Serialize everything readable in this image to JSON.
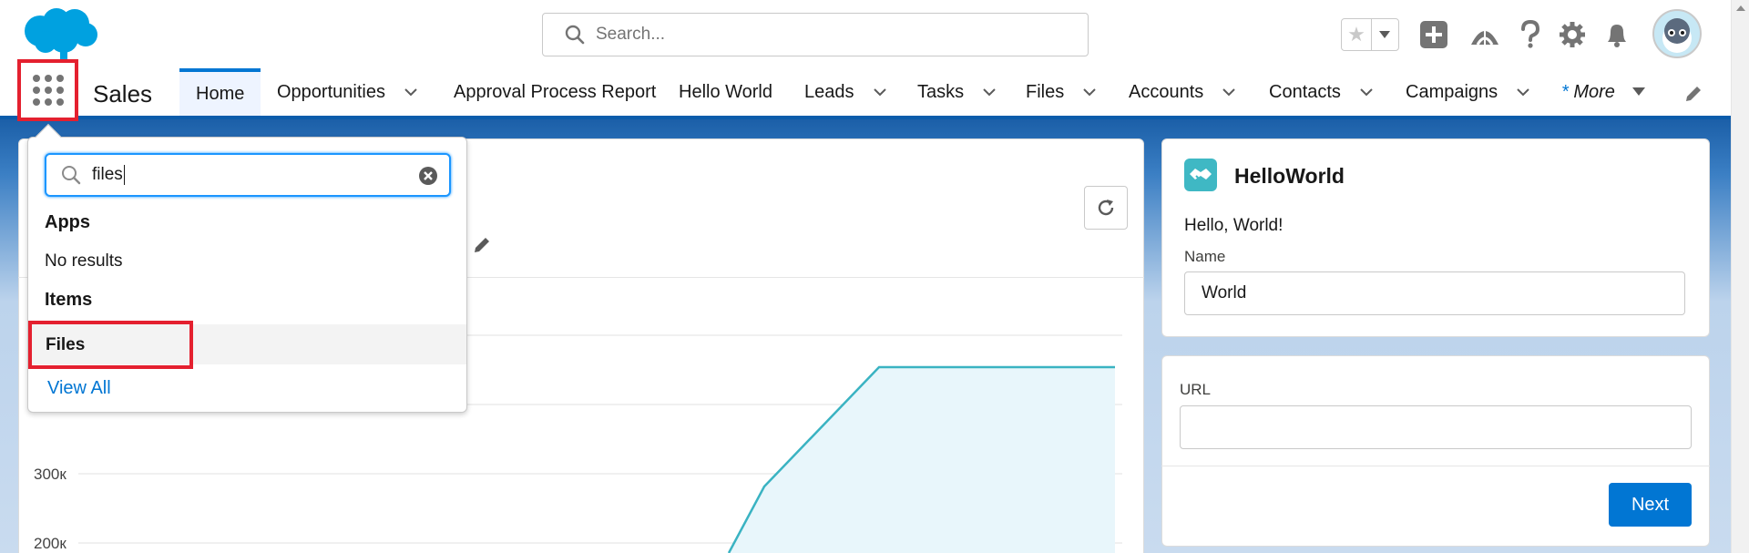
{
  "header": {
    "search_placeholder": "Search..."
  },
  "nav": {
    "app_name": "Sales",
    "tabs": [
      {
        "label": "Home"
      },
      {
        "label": "Opportunities"
      },
      {
        "label": "Approval Process Report"
      },
      {
        "label": "Hello World"
      },
      {
        "label": "Leads"
      },
      {
        "label": "Tasks"
      },
      {
        "label": "Files"
      },
      {
        "label": "Accounts"
      },
      {
        "label": "Contacts"
      },
      {
        "label": "Campaigns"
      }
    ],
    "more_star": "*",
    "more_label": "More"
  },
  "launcher": {
    "search_value": "files",
    "apps_heading": "Apps",
    "no_results": "No results",
    "items_heading": "Items",
    "item_files": "Files",
    "view_all": "View All"
  },
  "chart": {
    "y_ticks": [
      "300к",
      "200к"
    ]
  },
  "chart_data": {
    "type": "area",
    "ylabel": "",
    "yticks_visible": [
      "200к",
      "300к"
    ]
  },
  "hello_world": {
    "title": "HelloWorld",
    "greeting": "Hello, World!",
    "name_label": "Name",
    "name_value": "World"
  },
  "url_card": {
    "url_label": "URL",
    "next_label": "Next"
  },
  "colors": {
    "brand": "#0176d3",
    "highlight": "#e4202f",
    "chart_line": "#3ab3c2",
    "chart_fill": "#e8f6fb"
  }
}
